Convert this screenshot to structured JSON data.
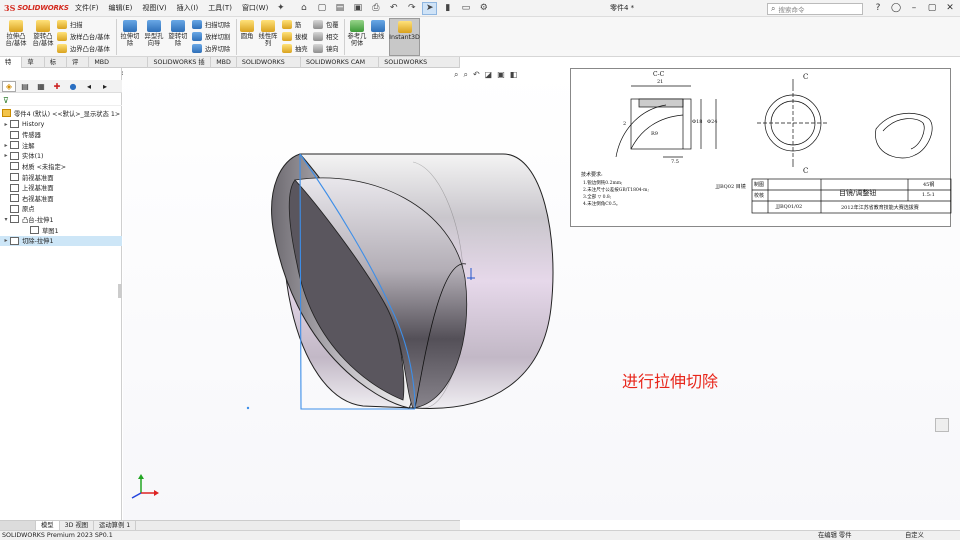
{
  "app": {
    "logo_ds": "3S",
    "logo_text": "SOLIDWORKS",
    "document_title": "零件4 *",
    "menus": [
      "文件(F)",
      "编辑(E)",
      "视图(V)",
      "插入(I)",
      "工具(T)",
      "窗口(W)"
    ],
    "search_placeholder": "搜索命令"
  },
  "command_manager": {
    "big_buttons": [
      {
        "label": "拉伸凸台/基体",
        "icon": "extrude-boss-icon"
      },
      {
        "label": "旋转凸台/基体",
        "icon": "revolve-boss-icon"
      },
      {
        "label": "拉伸切除",
        "icon": "extrude-cut-icon"
      },
      {
        "label": "异型孔向导",
        "icon": "hole-wizard-icon"
      },
      {
        "label": "旋转切除",
        "icon": "revolve-cut-icon"
      },
      {
        "label": "圆角",
        "icon": "fillet-icon"
      },
      {
        "label": "线性阵列",
        "icon": "linear-pattern-icon"
      },
      {
        "label": "参考几何体",
        "icon": "reference-geometry-icon"
      },
      {
        "label": "曲线",
        "icon": "curves-icon"
      },
      {
        "label": "Instant3D",
        "icon": "instant3d-icon"
      }
    ],
    "small_buttons_group1": [
      "扫描",
      "放样凸台/基体",
      "边界凸台/基体"
    ],
    "small_buttons_group2": [
      "扫描切除",
      "放样切割",
      "边界切除"
    ],
    "small_buttons_group3": [
      "筋",
      "拔模",
      "抽壳"
    ],
    "small_buttons_group4": [
      "包覆",
      "相交",
      "镜向"
    ]
  },
  "tabs": [
    "特征",
    "草图",
    "标注",
    "评估",
    "MBD Dimensions",
    "SOLIDWORKS 插件",
    "MBD",
    "SOLIDWORKS CAM",
    "SOLIDWORKS CAM TBM",
    "SOLIDWORKS Inspection"
  ],
  "tree": {
    "root": "零件4 (默认) <<默认>_显示状态 1>",
    "items": [
      {
        "label": "History",
        "expand": "▸",
        "icon": "history-icon"
      },
      {
        "label": "传感器",
        "expand": "",
        "icon": "sensor-icon"
      },
      {
        "label": "注解",
        "expand": "▸",
        "icon": "annotation-icon"
      },
      {
        "label": "实体(1)",
        "expand": "▸",
        "icon": "solid-body-icon"
      },
      {
        "label": "材质 <未指定>",
        "expand": "",
        "icon": "material-icon"
      },
      {
        "label": "前视基准面",
        "expand": "",
        "icon": "plane-icon"
      },
      {
        "label": "上视基准面",
        "expand": "",
        "icon": "plane-icon"
      },
      {
        "label": "右视基准面",
        "expand": "",
        "icon": "plane-icon"
      },
      {
        "label": "原点",
        "expand": "",
        "icon": "origin-icon"
      },
      {
        "label": "凸台-拉伸1",
        "expand": "▾",
        "icon": "extrude-feature-icon"
      },
      {
        "label": "草图1",
        "expand": "",
        "icon": "sketch-icon"
      },
      {
        "label": "切除-拉伸1",
        "expand": "▸",
        "icon": "cut-feature-icon"
      }
    ]
  },
  "bottom_tabs": [
    "模型",
    "3D 视图",
    "运动算例 1"
  ],
  "status": {
    "left": "SOLIDWORKS Premium 2023 SP0.1",
    "mode": "在编辑 零件",
    "units": "自定义"
  },
  "drawing": {
    "section_label": "C-C",
    "dim_21": "21",
    "dim_2": "2",
    "dim_phi18": "Φ18",
    "dim_phi24": "Φ24",
    "dim_r": "R9",
    "dim_7": "7.5",
    "c_top": "C",
    "c_bot": "C",
    "notes_title": "技术要求:",
    "notes": [
      "1.锐边倒钝0.2mm;",
      "2.未注尺寸公差按GB/T1804-m;",
      "3.全部 ▽ 0.8;",
      "4.未注倒角C0.5。"
    ],
    "part_no": "JJBQ02 目镜",
    "title": "目镜/调整钮",
    "material": "45钢",
    "scale": "1.5:1",
    "drawing_no": "JJBQ01/02",
    "org": "2012年江苏省教育技能大赛选拔赛",
    "row1": "制图",
    "row2": "校核"
  },
  "caption": "进行拉伸切除"
}
